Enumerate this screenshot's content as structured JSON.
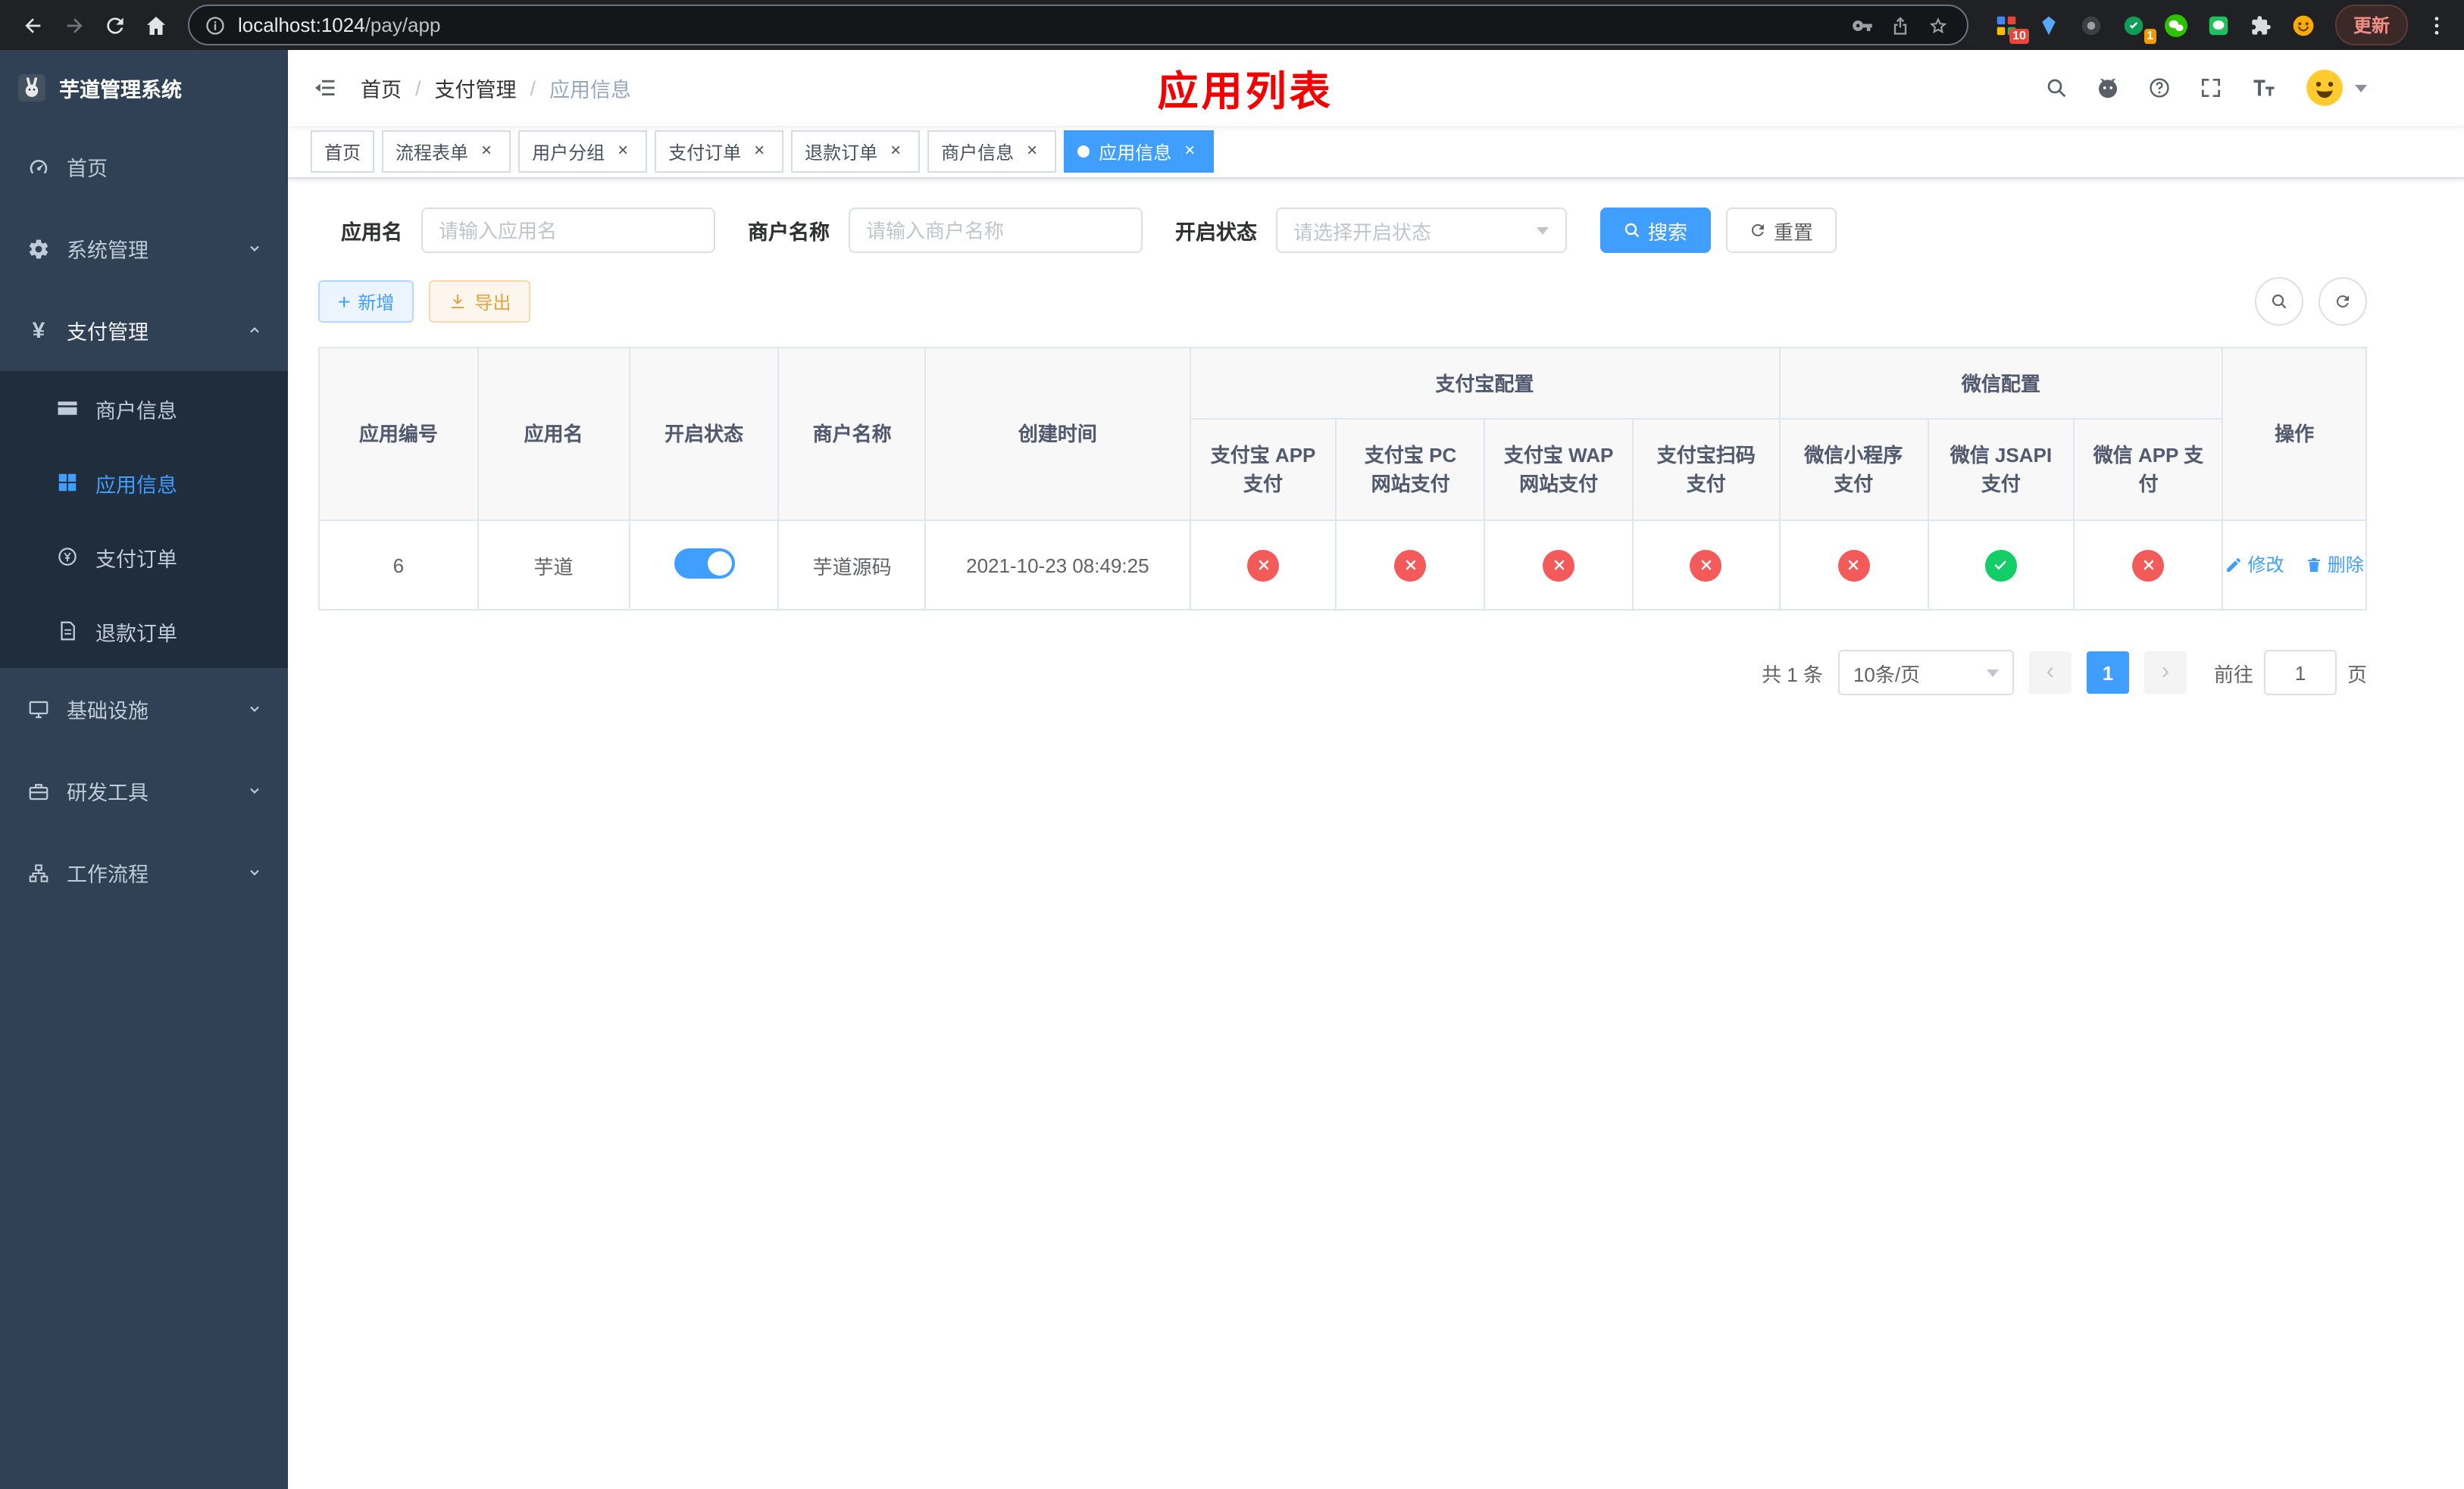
{
  "browser": {
    "url_host": "localhost:1024",
    "url_path": "/pay/app",
    "update_label": "更新",
    "extension_badges": {
      "grid": "10",
      "green": "1"
    }
  },
  "sidebar": {
    "logo_title": "芋道管理系统",
    "items": {
      "home": "首页",
      "system": "系统管理",
      "payment": "支付管理",
      "merchant_info": "商户信息",
      "app_info": "应用信息",
      "pay_order": "支付订单",
      "refund_order": "退款订单",
      "infrastructure": "基础设施",
      "dev_tools": "研发工具",
      "workflow": "工作流程"
    }
  },
  "header": {
    "breadcrumb": [
      "首页",
      "支付管理",
      "应用信息"
    ],
    "page_title": "应用列表"
  },
  "tabs": [
    {
      "label": "首页",
      "closable": false,
      "active": false
    },
    {
      "label": "流程表单",
      "closable": true,
      "active": false
    },
    {
      "label": "用户分组",
      "closable": true,
      "active": false
    },
    {
      "label": "支付订单",
      "closable": true,
      "active": false
    },
    {
      "label": "退款订单",
      "closable": true,
      "active": false
    },
    {
      "label": "商户信息",
      "closable": true,
      "active": false
    },
    {
      "label": "应用信息",
      "closable": true,
      "active": true
    }
  ],
  "filters": {
    "app_name_label": "应用名",
    "app_name_placeholder": "请输入应用名",
    "app_name_value": "",
    "merchant_label": "商户名称",
    "merchant_placeholder": "请输入商户名称",
    "merchant_value": "",
    "status_label": "开启状态",
    "status_placeholder": "请选择开启状态",
    "search_label": "搜索",
    "reset_label": "重置"
  },
  "toolbar": {
    "add_label": "新增",
    "export_label": "导出"
  },
  "table": {
    "columns": {
      "app_id": "应用编号",
      "app_name": "应用名",
      "status": "开启状态",
      "merchant": "商户名称",
      "created": "创建时间",
      "alipay_group": "支付宝配置",
      "wechat_group": "微信配置",
      "alipay_app": "支付宝 APP 支付",
      "alipay_pc": "支付宝 PC 网站支付",
      "alipay_wap": "支付宝 WAP 网站支付",
      "alipay_qr": "支付宝扫码支付",
      "wx_lite": "微信小程序支付",
      "wx_jsapi": "微信 JSAPI 支付",
      "wx_app": "微信 APP 支付",
      "actions": "操作"
    },
    "rows": [
      {
        "app_id": "6",
        "app_name": "芋道",
        "status_on": true,
        "merchant": "芋道源码",
        "created": "2021-10-23 08:49:25",
        "alipay_app": false,
        "alipay_pc": false,
        "alipay_wap": false,
        "alipay_qr": false,
        "wx_lite": false,
        "wx_jsapi": true,
        "wx_app": false,
        "edit_label": "修改",
        "delete_label": "删除"
      }
    ]
  },
  "pagination": {
    "total": "共 1 条",
    "page_size": "10条/页",
    "current_page": "1",
    "goto_label": "前往",
    "goto_value": "1",
    "goto_suffix": "页"
  },
  "colors": {
    "primary": "#409eff",
    "danger": "#f35b5b",
    "success": "#13ce66",
    "warning": "#e6a23c",
    "title_red": "#f40000",
    "sidebar_bg": "#304156",
    "submenu_bg": "#1f2d3d"
  }
}
